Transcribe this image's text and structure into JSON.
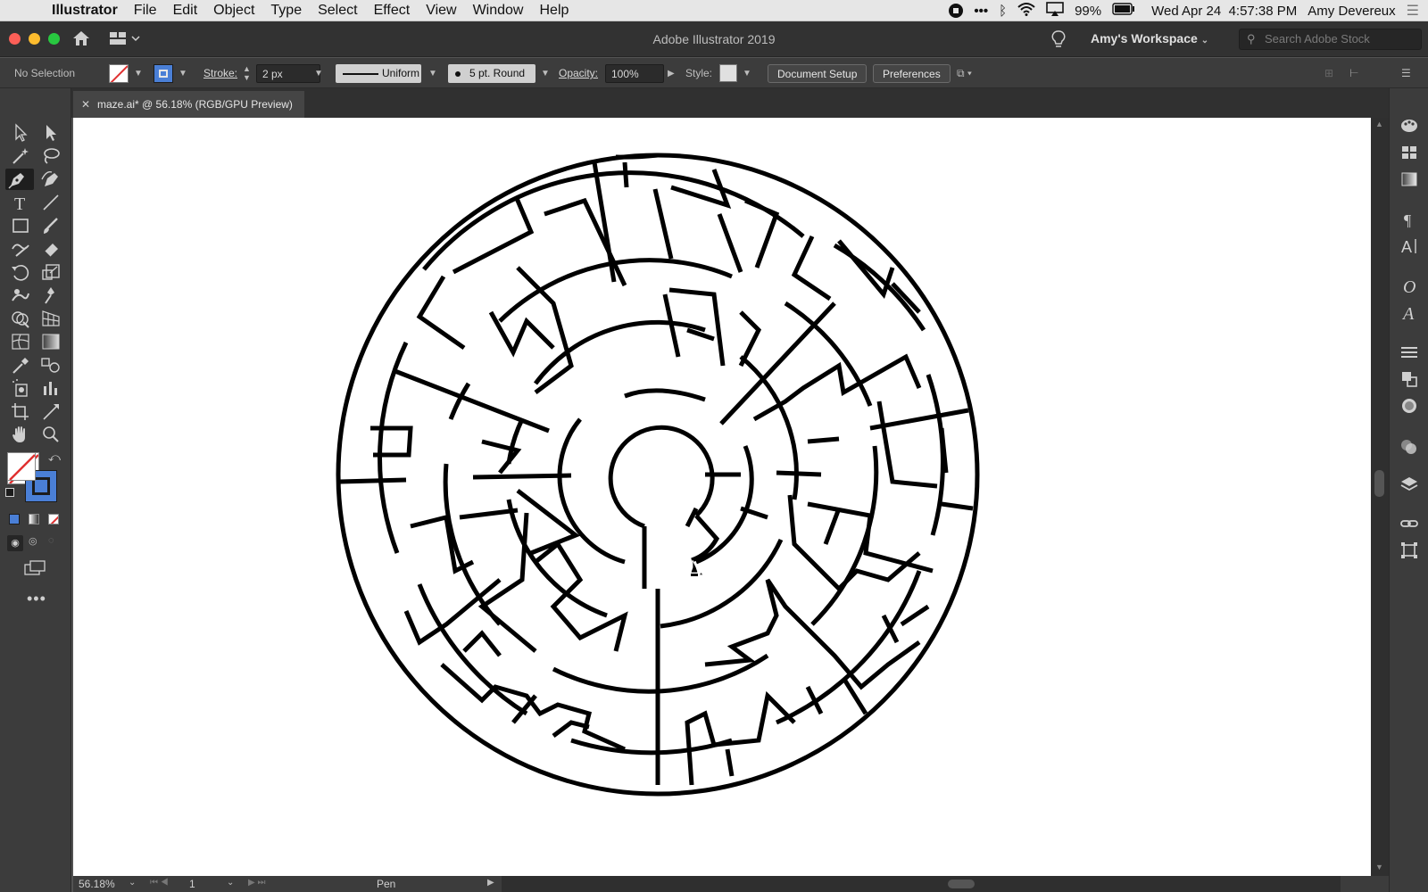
{
  "menubar": {
    "app_name": "Illustrator",
    "items": [
      "File",
      "Edit",
      "Object",
      "Type",
      "Select",
      "Effect",
      "View",
      "Window",
      "Help"
    ],
    "battery": "99%",
    "clock": "Wed Apr 24  4:57:38 PM",
    "user": "Amy Devereux"
  },
  "titlebar": {
    "app_title": "Adobe Illustrator 2019",
    "workspace": "Amy's Workspace",
    "search_placeholder": "Search Adobe Stock"
  },
  "control_bar": {
    "selection": "No Selection",
    "stroke_label": "Stroke:",
    "stroke_value": "2 px",
    "profile": "Uniform",
    "brush": "5 pt. Round",
    "opacity_label": "Opacity:",
    "opacity_value": "100%",
    "style_label": "Style:",
    "document_setup": "Document Setup",
    "preferences": "Preferences"
  },
  "document_tab": {
    "title": "maze.ai* @ 56.18% (RGB/GPU Preview)"
  },
  "status_bar": {
    "zoom": "56.18%",
    "page": "1",
    "current_tool": "Pen"
  },
  "colors": {
    "fill_none_slash": "#e03030",
    "stroke_blue": "#4a7fd6",
    "canvas": "#ffffff",
    "chrome_dark": "#3c3c3c"
  },
  "tools_left": [
    "selection-icon",
    "direct-selection-icon",
    "magic-wand-icon",
    "lasso-icon",
    "pen-icon",
    "curvature-icon",
    "type-icon",
    "line-icon",
    "rectangle-icon",
    "paintbrush-icon",
    "shaper-icon",
    "eraser-icon",
    "rotate-icon",
    "scale-icon",
    "warp-icon",
    "puppet-warp-icon",
    "shape-builder-icon",
    "perspective-grid-icon",
    "mesh-icon",
    "gradient-icon",
    "eyedropper-icon",
    "blend-icon",
    "symbol-sprayer-icon",
    "column-graph-icon",
    "artboard-icon",
    "slice-icon",
    "hand-icon",
    "zoom-icon"
  ],
  "panels_right": [
    "color-guide-icon",
    "swatches-icon",
    "gradient-panel-icon",
    "paragraph-icon",
    "character-icon",
    "opentype-icon",
    "glyphs-icon",
    "align-icon",
    "pathfinder-icon",
    "appearance-icon",
    "transparency-icon",
    "layers-icon",
    "links-icon",
    "transform-icon"
  ]
}
